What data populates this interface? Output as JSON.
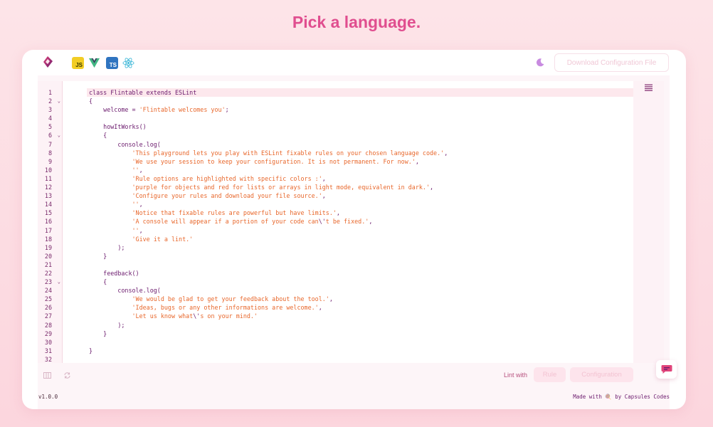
{
  "headline": "Pick a language.",
  "toolbar": {
    "languages": [
      {
        "name": "javascript-icon",
        "label": "JS"
      },
      {
        "name": "vue-icon",
        "label": ""
      },
      {
        "name": "typescript-icon",
        "label": "TS"
      },
      {
        "name": "react-icon",
        "label": ""
      }
    ],
    "download_label": "Download Configuration File"
  },
  "editor": {
    "line_numbers": [
      "1",
      "2",
      "3",
      "4",
      "5",
      "6",
      "7",
      "8",
      "9",
      "10",
      "11",
      "12",
      "13",
      "14",
      "15",
      "16",
      "17",
      "18",
      "19",
      "20",
      "21",
      "22",
      "23",
      "24",
      "25",
      "26",
      "27",
      "28",
      "29",
      "30",
      "31",
      "32"
    ],
    "fold_lines": [
      2,
      6,
      23
    ],
    "lines": [
      [
        {
          "t": "class Flintable extends ESLint",
          "c": "kw"
        }
      ],
      [
        {
          "t": "{",
          "c": "pl"
        }
      ],
      [
        {
          "t": "    welcome = ",
          "c": "pl"
        },
        {
          "t": "'Flintable welcomes you'",
          "c": "str"
        },
        {
          "t": ";",
          "c": "pl"
        }
      ],
      [],
      [
        {
          "t": "    howItWorks()",
          "c": "pl"
        }
      ],
      [
        {
          "t": "    {",
          "c": "pl"
        }
      ],
      [
        {
          "t": "        console.log(",
          "c": "pl"
        }
      ],
      [
        {
          "t": "            'This playground lets you play with ESLint fixable rules on your chosen language code.'",
          "c": "str"
        },
        {
          "t": ",",
          "c": "pl"
        }
      ],
      [
        {
          "t": "            'We use your session to keep your configuration. It is not permanent. For now.'",
          "c": "str"
        },
        {
          "t": ",",
          "c": "pl"
        }
      ],
      [
        {
          "t": "            ''",
          "c": "str"
        },
        {
          "t": ",",
          "c": "pl"
        }
      ],
      [
        {
          "t": "            'Rule options are highlighted with specific colors :'",
          "c": "str"
        },
        {
          "t": ",",
          "c": "pl"
        }
      ],
      [
        {
          "t": "            'purple for objects and red for lists or arrays in light mode, equivalent in dark.'",
          "c": "str"
        },
        {
          "t": ",",
          "c": "pl"
        }
      ],
      [
        {
          "t": "            'Configure your rules and download your file source.'",
          "c": "str"
        },
        {
          "t": ",",
          "c": "pl"
        }
      ],
      [
        {
          "t": "            ''",
          "c": "str"
        },
        {
          "t": ",",
          "c": "pl"
        }
      ],
      [
        {
          "t": "            'Notice that fixable rules are powerful but have limits.'",
          "c": "str"
        },
        {
          "t": ",",
          "c": "pl"
        }
      ],
      [
        {
          "t": "            'A console will appear if a portion of your code can",
          "c": "str"
        },
        {
          "t": "\\'",
          "c": "pl"
        },
        {
          "t": "t be fixed.'",
          "c": "str"
        },
        {
          "t": ",",
          "c": "pl"
        }
      ],
      [
        {
          "t": "            ''",
          "c": "str"
        },
        {
          "t": ",",
          "c": "pl"
        }
      ],
      [
        {
          "t": "            'Give it a lint.'",
          "c": "str"
        }
      ],
      [
        {
          "t": "        );",
          "c": "pl"
        }
      ],
      [
        {
          "t": "    }",
          "c": "pl"
        }
      ],
      [],
      [
        {
          "t": "    feedback()",
          "c": "pl"
        }
      ],
      [
        {
          "t": "    {",
          "c": "pl"
        }
      ],
      [
        {
          "t": "        console.log(",
          "c": "pl"
        }
      ],
      [
        {
          "t": "            'We would be glad to get your feedback about the tool.'",
          "c": "str"
        },
        {
          "t": ",",
          "c": "pl"
        }
      ],
      [
        {
          "t": "            'Ideas, bugs or any other informations are welcome.'",
          "c": "str"
        },
        {
          "t": ",",
          "c": "pl"
        }
      ],
      [
        {
          "t": "            'Let us know what",
          "c": "str"
        },
        {
          "t": "\\'",
          "c": "pl"
        },
        {
          "t": "s on your mind.'",
          "c": "str"
        }
      ],
      [
        {
          "t": "        );",
          "c": "pl"
        }
      ],
      [
        {
          "t": "    }",
          "c": "pl"
        }
      ],
      [],
      [
        {
          "t": "}",
          "c": "pl"
        }
      ],
      []
    ]
  },
  "lint": {
    "label": "Lint with",
    "rule_label": "Rule",
    "configuration_label": "Configuration"
  },
  "footer": {
    "version": "v1.0.0",
    "credit": "Made with 🍭 by Capsules Codes"
  },
  "colors": {
    "accent": "#e04e8f",
    "keyword": "#6b1a6d",
    "string": "#e8672b"
  }
}
